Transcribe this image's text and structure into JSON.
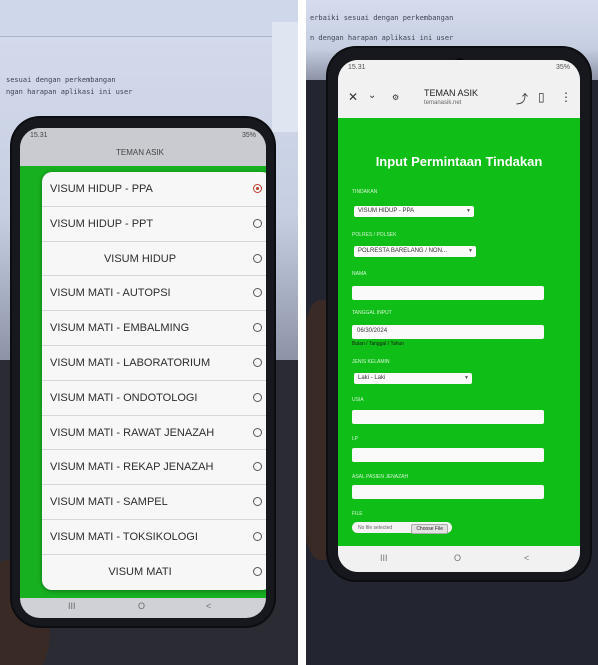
{
  "left_phone": {
    "status_time": "15.31",
    "status_right": "35%",
    "app_title": "TEMAN ASIK",
    "options": [
      {
        "label": "VISUM HIDUP - PPA",
        "selected": true,
        "centered": false
      },
      {
        "label": "VISUM HIDUP - PPT",
        "selected": false,
        "centered": false
      },
      {
        "label": "VISUM HIDUP",
        "selected": false,
        "centered": true
      },
      {
        "label": "VISUM MATI - AUTOPSI",
        "selected": false,
        "centered": false
      },
      {
        "label": "VISUM MATI - EMBALMING",
        "selected": false,
        "centered": false
      },
      {
        "label": "VISUM MATI - LABORATORIUM",
        "selected": false,
        "centered": false
      },
      {
        "label": "VISUM MATI - ONDOTOLOGI",
        "selected": false,
        "centered": false
      },
      {
        "label": "VISUM MATI - RAWAT JENAZAH",
        "selected": false,
        "centered": false
      },
      {
        "label": "VISUM MATI - REKAP JENAZAH",
        "selected": false,
        "centered": false
      },
      {
        "label": "VISUM MATI - SAMPEL",
        "selected": false,
        "centered": false
      },
      {
        "label": "VISUM MATI - TOKSIKOLOGI",
        "selected": false,
        "centered": false
      },
      {
        "label": "VISUM MATI",
        "selected": false,
        "centered": true
      }
    ],
    "nav": {
      "recents": "III",
      "home": "O",
      "back": "<"
    }
  },
  "right_phone": {
    "status_time": "15.31",
    "status_right": "35%",
    "site_title": "TEMAN ASIK",
    "site_url": "temanasik.net",
    "page_title": "Input Permintaan Tindakan",
    "fields": {
      "tindakan_label": "TINDAKAN",
      "tindakan_value": "VISUM HIDUP - PPA",
      "polres_label": "POLRES / POLSEK",
      "polres_value": "POLRESTA BARELANG / NON...",
      "nama_label": "NAMA",
      "tanggal_label": "TANGGAL INPUT",
      "tanggal_value": "06/30/2024",
      "tanggal_hint": "Bulan / Tanggal / Tahun",
      "jenis_kelamin_label": "JENIS KELAMIN",
      "jenis_kelamin_value": "Laki - Laki",
      "usia_label": "USIA",
      "lp_label": "LP",
      "asal_label": "ASAL PASIEN JENAZAH",
      "file_label": "FILE",
      "file_none": "No file selected",
      "file_button": "Choose File"
    },
    "nav": {
      "recents": "III",
      "home": "O",
      "back": "<"
    }
  },
  "background_text": {
    "line1": "sesuai dengan perkembangan",
    "line2": "ngan harapan aplikasi ini user",
    "line3": "erbaiki sesuai dengan perkembangan",
    "line4": "n dengan harapan aplikasi ini user"
  },
  "colors": {
    "app_green": "#0fbe16",
    "selected_radio": "#c0392b"
  }
}
